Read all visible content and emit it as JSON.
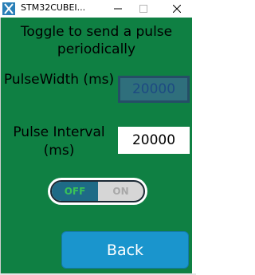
{
  "window": {
    "title": "STM32CUBEI...",
    "minimize_icon": "minimize-icon",
    "maximize_icon": "maximize-icon",
    "close_icon": "close-icon"
  },
  "heading": "Toggle to send a pulse periodically",
  "pulse_width": {
    "label": "PulseWidth (ms)",
    "value": "20000"
  },
  "pulse_interval": {
    "label": "Pulse Interval (ms)",
    "value": "20000"
  },
  "toggle": {
    "off_label": "OFF",
    "on_label": "ON",
    "state": "off"
  },
  "back_button": {
    "label": "Back"
  },
  "colors": {
    "background": "#0f8043",
    "button": "#1a95cd",
    "toggle_active": "#1e6b86",
    "toggle_text_active": "#39c258"
  }
}
